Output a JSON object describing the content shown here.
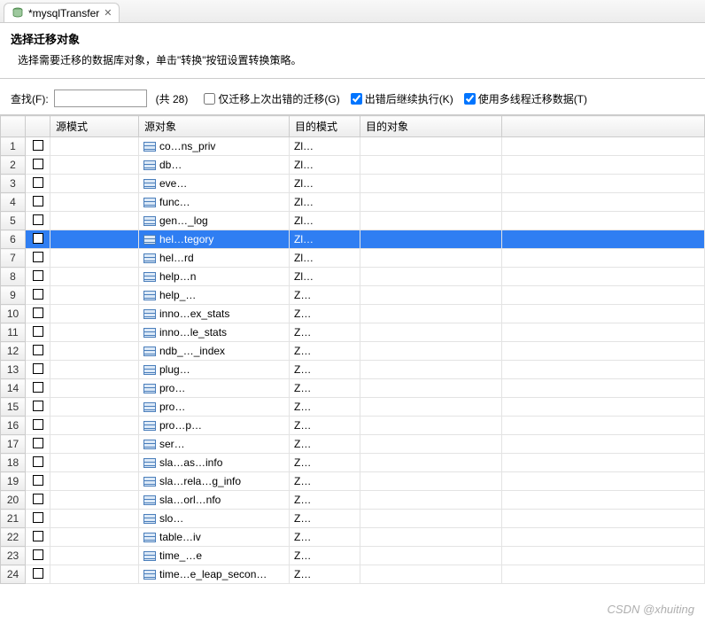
{
  "tab": {
    "title": "*mysqlTransfer"
  },
  "header": {
    "title": "选择迁移对象",
    "subtitle": "选择需要迁移的数据库对象，单击\"转换\"按钮设置转换策略。"
  },
  "controls": {
    "search_label": "查找(F):",
    "search_value": "",
    "count_text": "(共 28)",
    "chk_prev_fail_label": "仅迁移上次出错的迁移(G)",
    "chk_prev_fail_checked": false,
    "chk_continue_label": "出错后继续执行(K)",
    "chk_continue_checked": true,
    "chk_multithread_label": "使用多线程迁移数据(T)",
    "chk_multithread_checked": true
  },
  "table": {
    "columns": {
      "rownum": "",
      "checkbox": "",
      "src_mode": "源模式",
      "src_obj": "源对象",
      "dst_mode": "目的模式",
      "dst_obj": "目的对象"
    },
    "rows": [
      {
        "n": 1,
        "chk": false,
        "src_obj": "co…ns_priv",
        "dst_mode": "Zl…",
        "selected": false
      },
      {
        "n": 2,
        "chk": false,
        "src_obj": "db…",
        "dst_mode": "Zl…",
        "selected": false
      },
      {
        "n": 3,
        "chk": false,
        "src_obj": "eve…",
        "dst_mode": "Zl…",
        "selected": false
      },
      {
        "n": 4,
        "chk": false,
        "src_obj": "func…",
        "dst_mode": "Zl…",
        "selected": false
      },
      {
        "n": 5,
        "chk": false,
        "src_obj": "gen…_log",
        "dst_mode": "Zl…",
        "selected": false
      },
      {
        "n": 6,
        "chk": false,
        "src_obj": "hel…tegory",
        "dst_mode": "Zl…",
        "selected": true
      },
      {
        "n": 7,
        "chk": false,
        "src_obj": "hel…rd",
        "dst_mode": "Zl…",
        "selected": false
      },
      {
        "n": 8,
        "chk": false,
        "src_obj": "help…n",
        "dst_mode": "Zl…",
        "selected": false
      },
      {
        "n": 9,
        "chk": false,
        "src_obj": "help_…",
        "dst_mode": "Z…",
        "selected": false
      },
      {
        "n": 10,
        "chk": false,
        "src_obj": "inno…ex_stats",
        "dst_mode": "Z…",
        "selected": false
      },
      {
        "n": 11,
        "chk": false,
        "src_obj": "inno…le_stats",
        "dst_mode": "Z…",
        "selected": false
      },
      {
        "n": 12,
        "chk": false,
        "src_obj": "ndb_…_index",
        "dst_mode": "Z…",
        "selected": false
      },
      {
        "n": 13,
        "chk": false,
        "src_obj": "plug…",
        "dst_mode": "Z…",
        "selected": false
      },
      {
        "n": 14,
        "chk": false,
        "src_obj": "pro…",
        "dst_mode": "Z…",
        "selected": false
      },
      {
        "n": 15,
        "chk": false,
        "src_obj": "pro…",
        "dst_mode": "Z…",
        "selected": false
      },
      {
        "n": 16,
        "chk": false,
        "src_obj": "pro…p…",
        "dst_mode": "Z…",
        "selected": false
      },
      {
        "n": 17,
        "chk": false,
        "src_obj": "ser…",
        "dst_mode": "Z…",
        "selected": false
      },
      {
        "n": 18,
        "chk": false,
        "src_obj": "sla…as…info",
        "dst_mode": "Z…",
        "selected": false
      },
      {
        "n": 19,
        "chk": false,
        "src_obj": "sla…rela…g_info",
        "dst_mode": "Z…",
        "selected": false
      },
      {
        "n": 20,
        "chk": false,
        "src_obj": "sla…orl…nfo",
        "dst_mode": "Z…",
        "selected": false
      },
      {
        "n": 21,
        "chk": false,
        "src_obj": "slo…",
        "dst_mode": "Z…",
        "selected": false
      },
      {
        "n": 22,
        "chk": false,
        "src_obj": "table…iv",
        "dst_mode": "Z…",
        "selected": false
      },
      {
        "n": 23,
        "chk": false,
        "src_obj": "time_…e",
        "dst_mode": "Z…",
        "selected": false
      },
      {
        "n": 24,
        "chk": false,
        "src_obj": "time…e_leap_secon…",
        "dst_mode": "Z…",
        "selected": false
      }
    ]
  },
  "watermark": "CSDN @xhuiting"
}
